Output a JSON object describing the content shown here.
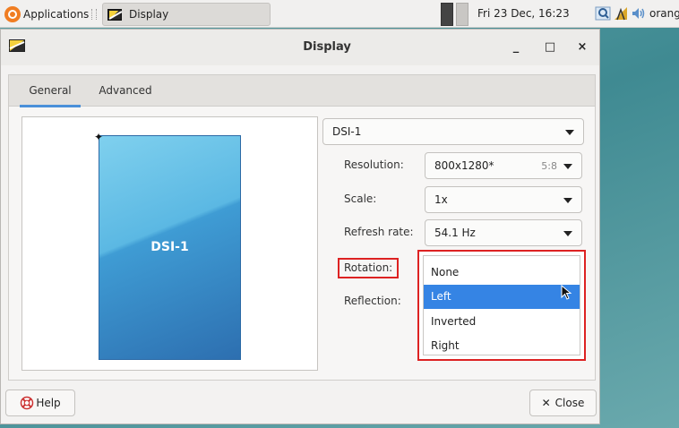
{
  "panel": {
    "apps_label": "Applications",
    "task_label": "Display",
    "clock": "Fri 23 Dec, 16:23",
    "user": "orangepi"
  },
  "window": {
    "title": "Display",
    "minimize": "_",
    "maximize": "□",
    "close": "×"
  },
  "tabs": [
    {
      "label": "General",
      "active": true
    },
    {
      "label": "Advanced",
      "active": false
    }
  ],
  "preview": {
    "monitor_label": "DSI-1",
    "primary_mark": "✦"
  },
  "output_select": {
    "value": "DSI-1"
  },
  "settings": {
    "resolution_label": "Resolution:",
    "resolution_value": "800x1280*",
    "resolution_ratio": "5:8",
    "scale_label": "Scale:",
    "scale_value": "1x",
    "refresh_label": "Refresh rate:",
    "refresh_value": "54.1 Hz",
    "rotation_label": "Rotation:",
    "reflection_label": "Reflection:"
  },
  "rotation_menu": {
    "items": [
      "None",
      "Left",
      "Inverted",
      "Right"
    ],
    "selected": "Left"
  },
  "footer": {
    "help_label": "Help",
    "close_label": "Close"
  },
  "colors": {
    "accent": "#3584e4",
    "highlight": "#dd2222",
    "tab_indicator": "#4a90d9"
  }
}
